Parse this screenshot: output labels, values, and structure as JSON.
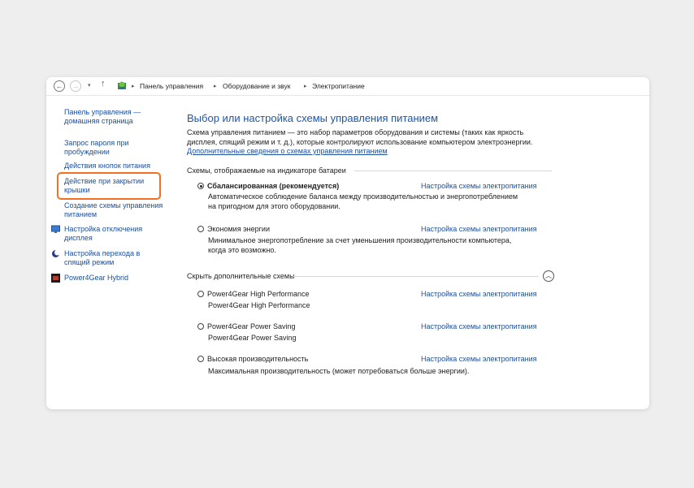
{
  "breadcrumb": {
    "items": [
      "Панель управления",
      "Оборудование и звук",
      "Электропитание"
    ],
    "back_glyph": "←",
    "forward_glyph": "→",
    "dropdown_glyph": "▾",
    "up_glyph": "↑",
    "separator_glyph": "▸"
  },
  "sidebar": {
    "home_line1": "Панель управления —",
    "home_line2": "домашняя страница",
    "password_line1": "Запрос пароля при",
    "password_line2": "пробуждении",
    "power_buttons": "Действия кнопок питания",
    "lid_line1": "Действие при закрытии",
    "lid_line2": "крышки",
    "create_line1": "Создание схемы управления",
    "create_line2": "питанием",
    "display_line1": "Настройка отключения",
    "display_line2": "дисплея",
    "sleep_line1": "Настройка перехода в",
    "sleep_line2": "спящий режим",
    "hybrid": "Power4Gear Hybrid"
  },
  "main": {
    "title": "Выбор или настройка схемы управления питанием",
    "desc_line1": "Схема управления питанием — это набор параметров оборудования и системы (таких как яркость",
    "desc_line2": "дисплея, спящий режим и т. д.), которые контролируют использование компьютером электроэнергии.",
    "more_link": "Дополнительные сведения о схемах управления питанием",
    "battery_section": "Схемы, отображаемые на индикаторе батареи",
    "hidden_section": "Скрыть дополнительные схемы",
    "collapse_glyph": "︿",
    "settings_link": "Настройка схемы электропитания",
    "plans": [
      {
        "name": "Сбалансированная (рекомендуется)",
        "desc1": "Автоматическое соблюдение баланса между производительностью и энергопотреблением",
        "desc2": "на пригодном для этого оборудовании.",
        "selected": true
      },
      {
        "name": "Экономия энергии",
        "desc1": "Минимальное энергопотребление за счет уменьшения производительности компьютера,",
        "desc2": "когда это возможно.",
        "selected": false
      }
    ],
    "extra_plans": [
      {
        "name": "Power4Gear High Performance",
        "desc": "Power4Gear High Performance",
        "selected": false
      },
      {
        "name": "Power4Gear Power Saving",
        "desc": "Power4Gear Power Saving",
        "selected": false
      },
      {
        "name": "Высокая производительность",
        "desc": "Максимальная производительность (может потребоваться больше энергии).",
        "selected": false
      }
    ]
  },
  "colors": {
    "link": "#1c4fa0",
    "title": "#1f55a5",
    "highlight": "#f36f21"
  }
}
